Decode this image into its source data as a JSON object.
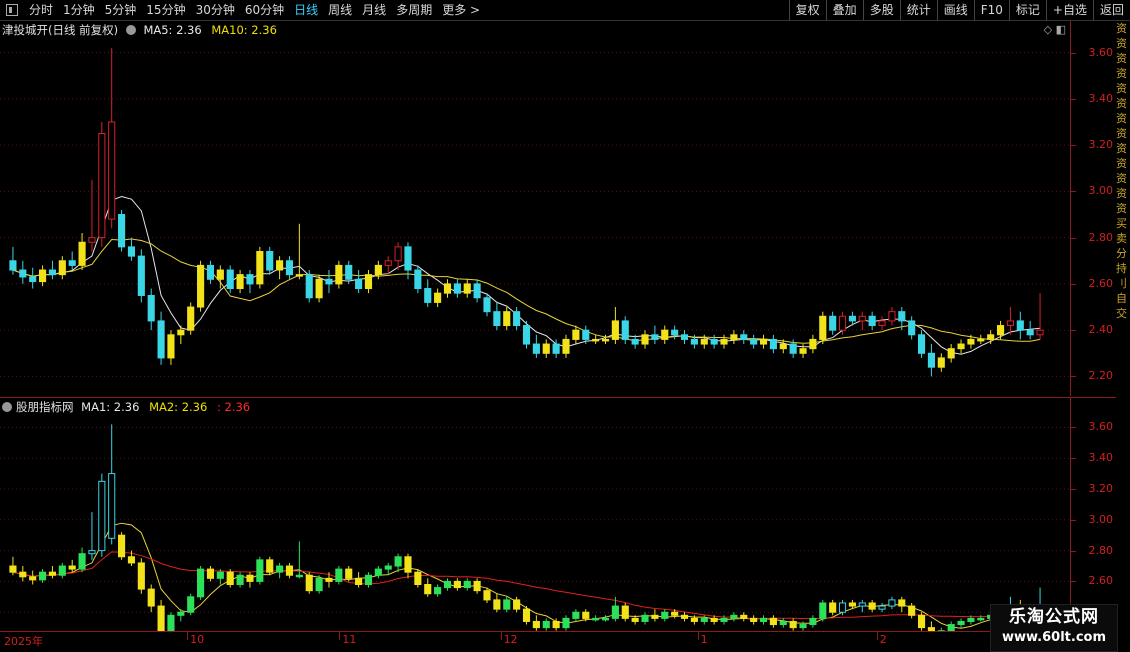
{
  "toolbar": {
    "periods": [
      "分时",
      "1分钟",
      "5分钟",
      "15分钟",
      "30分钟",
      "60分钟",
      "日线",
      "周线",
      "月线",
      "多周期",
      "更多 >"
    ],
    "active_period": "日线",
    "actions": [
      "复权",
      "叠加",
      "多股",
      "统计",
      "画线",
      "F10",
      "标记",
      "+自选",
      "返回"
    ]
  },
  "main": {
    "title": "津投城开(日线 前复权)",
    "ma5": "MA5: 2.36",
    "ma10": "MA10: 2.36",
    "ticks": [
      "3.60",
      "3.40",
      "3.20",
      "3.00",
      "2.80",
      "2.60",
      "2.40",
      "2.20"
    ]
  },
  "sub": {
    "title": "股朋指标网",
    "ma1": "MA1: 2.36",
    "ma2": "MA2: 2.36",
    "ma3": ": 2.36",
    "ticks": [
      "3.60",
      "3.40",
      "3.20",
      "3.00",
      "2.80",
      "2.60",
      "2.40"
    ]
  },
  "dates": [
    "2025年",
    "10",
    "11",
    "12",
    "1",
    "2",
    "3"
  ],
  "side_strip": [
    "资",
    "资",
    "资",
    "资",
    "资",
    "资",
    "资",
    "资",
    "资",
    "资",
    "资",
    "资",
    "资",
    "买",
    "卖",
    "分",
    "持",
    "刂",
    "自",
    "交"
  ],
  "watermark": {
    "title": "乐淘公式网",
    "url": "www.60lt.com"
  },
  "colors": {
    "up_red": "#d8202a",
    "up_yellow": "#f2e21a",
    "down_cyan": "#3ad6e6",
    "ma_white": "#e6e6e6",
    "ma_yellow": "#e8d23a",
    "ma_red": "#e02020",
    "accent": "#3ad1ff"
  },
  "chart_data": {
    "type": "candlestick",
    "axis_range": [
      2.15,
      3.65
    ],
    "sub_axis_range": [
      2.33,
      3.7
    ],
    "ma5_last": 2.36,
    "ma10_last": 2.36,
    "candles": [
      [
        2.7,
        2.76,
        2.64,
        2.66
      ],
      [
        2.66,
        2.7,
        2.6,
        2.63
      ],
      [
        2.63,
        2.67,
        2.58,
        2.61
      ],
      [
        2.61,
        2.68,
        2.59,
        2.66
      ],
      [
        2.66,
        2.7,
        2.62,
        2.64
      ],
      [
        2.64,
        2.72,
        2.62,
        2.7
      ],
      [
        2.7,
        2.74,
        2.66,
        2.68
      ],
      [
        2.68,
        2.82,
        2.66,
        2.78
      ],
      [
        2.78,
        3.05,
        2.74,
        2.8
      ],
      [
        2.8,
        3.3,
        2.76,
        3.25
      ],
      [
        2.88,
        3.62,
        2.84,
        3.3
      ],
      [
        2.9,
        2.92,
        2.74,
        2.76
      ],
      [
        2.76,
        2.8,
        2.7,
        2.72
      ],
      [
        2.72,
        2.75,
        2.52,
        2.55
      ],
      [
        2.55,
        2.58,
        2.4,
        2.44
      ],
      [
        2.44,
        2.48,
        2.25,
        2.28
      ],
      [
        2.28,
        2.4,
        2.25,
        2.38
      ],
      [
        2.38,
        2.42,
        2.34,
        2.4
      ],
      [
        2.4,
        2.52,
        2.38,
        2.5
      ],
      [
        2.5,
        2.7,
        2.48,
        2.68
      ],
      [
        2.68,
        2.7,
        2.6,
        2.62
      ],
      [
        2.62,
        2.68,
        2.58,
        2.66
      ],
      [
        2.66,
        2.68,
        2.56,
        2.58
      ],
      [
        2.58,
        2.66,
        2.56,
        2.64
      ],
      [
        2.64,
        2.66,
        2.56,
        2.6
      ],
      [
        2.6,
        2.76,
        2.58,
        2.74
      ],
      [
        2.74,
        2.76,
        2.64,
        2.66
      ],
      [
        2.66,
        2.72,
        2.62,
        2.7
      ],
      [
        2.7,
        2.72,
        2.62,
        2.64
      ],
      [
        2.64,
        2.86,
        2.62,
        2.64
      ],
      [
        2.64,
        2.66,
        2.52,
        2.54
      ],
      [
        2.54,
        2.64,
        2.52,
        2.62
      ],
      [
        2.62,
        2.66,
        2.56,
        2.6
      ],
      [
        2.6,
        2.7,
        2.58,
        2.68
      ],
      [
        2.68,
        2.7,
        2.6,
        2.62
      ],
      [
        2.62,
        2.66,
        2.56,
        2.58
      ],
      [
        2.58,
        2.66,
        2.56,
        2.64
      ],
      [
        2.64,
        2.7,
        2.62,
        2.68
      ],
      [
        2.68,
        2.72,
        2.64,
        2.7
      ],
      [
        2.7,
        2.78,
        2.66,
        2.76
      ],
      [
        2.76,
        2.78,
        2.62,
        2.66
      ],
      [
        2.66,
        2.68,
        2.56,
        2.58
      ],
      [
        2.58,
        2.62,
        2.5,
        2.52
      ],
      [
        2.52,
        2.58,
        2.5,
        2.56
      ],
      [
        2.56,
        2.62,
        2.54,
        2.6
      ],
      [
        2.6,
        2.62,
        2.54,
        2.56
      ],
      [
        2.56,
        2.62,
        2.54,
        2.6
      ],
      [
        2.6,
        2.62,
        2.52,
        2.54
      ],
      [
        2.54,
        2.56,
        2.46,
        2.48
      ],
      [
        2.48,
        2.52,
        2.4,
        2.42
      ],
      [
        2.42,
        2.5,
        2.4,
        2.48
      ],
      [
        2.48,
        2.5,
        2.4,
        2.42
      ],
      [
        2.42,
        2.44,
        2.32,
        2.34
      ],
      [
        2.34,
        2.38,
        2.28,
        2.3
      ],
      [
        2.3,
        2.36,
        2.28,
        2.34
      ],
      [
        2.34,
        2.36,
        2.28,
        2.3
      ],
      [
        2.3,
        2.38,
        2.28,
        2.36
      ],
      [
        2.36,
        2.42,
        2.34,
        2.4
      ],
      [
        2.4,
        2.42,
        2.34,
        2.36
      ],
      [
        2.36,
        2.38,
        2.34,
        2.36
      ],
      [
        2.36,
        2.38,
        2.34,
        2.36
      ],
      [
        2.36,
        2.5,
        2.34,
        2.44
      ],
      [
        2.44,
        2.46,
        2.34,
        2.36
      ],
      [
        2.36,
        2.38,
        2.32,
        2.34
      ],
      [
        2.34,
        2.4,
        2.32,
        2.38
      ],
      [
        2.38,
        2.42,
        2.34,
        2.36
      ],
      [
        2.36,
        2.42,
        2.34,
        2.4
      ],
      [
        2.4,
        2.42,
        2.36,
        2.38
      ],
      [
        2.38,
        2.4,
        2.34,
        2.36
      ],
      [
        2.36,
        2.38,
        2.32,
        2.34
      ],
      [
        2.34,
        2.38,
        2.32,
        2.36
      ],
      [
        2.36,
        2.38,
        2.32,
        2.34
      ],
      [
        2.34,
        2.38,
        2.32,
        2.36
      ],
      [
        2.36,
        2.4,
        2.34,
        2.38
      ],
      [
        2.38,
        2.4,
        2.34,
        2.36
      ],
      [
        2.36,
        2.38,
        2.32,
        2.34
      ],
      [
        2.34,
        2.38,
        2.32,
        2.36
      ],
      [
        2.36,
        2.38,
        2.3,
        2.32
      ],
      [
        2.32,
        2.36,
        2.3,
        2.34
      ],
      [
        2.34,
        2.36,
        2.28,
        2.3
      ],
      [
        2.3,
        2.34,
        2.28,
        2.32
      ],
      [
        2.32,
        2.38,
        2.3,
        2.36
      ],
      [
        2.36,
        2.48,
        2.34,
        2.46
      ],
      [
        2.46,
        2.48,
        2.38,
        2.4
      ],
      [
        2.4,
        2.48,
        2.38,
        2.46
      ],
      [
        2.46,
        2.48,
        2.42,
        2.44
      ],
      [
        2.44,
        2.48,
        2.4,
        2.46
      ],
      [
        2.46,
        2.48,
        2.4,
        2.42
      ],
      [
        2.42,
        2.46,
        2.4,
        2.44
      ],
      [
        2.44,
        2.5,
        2.42,
        2.48
      ],
      [
        2.48,
        2.5,
        2.4,
        2.44
      ],
      [
        2.44,
        2.46,
        2.36,
        2.38
      ],
      [
        2.38,
        2.4,
        2.28,
        2.3
      ],
      [
        2.3,
        2.34,
        2.2,
        2.24
      ],
      [
        2.24,
        2.3,
        2.22,
        2.28
      ],
      [
        2.28,
        2.34,
        2.26,
        2.32
      ],
      [
        2.32,
        2.36,
        2.3,
        2.34
      ],
      [
        2.34,
        2.38,
        2.32,
        2.36
      ],
      [
        2.36,
        2.38,
        2.34,
        2.36
      ],
      [
        2.36,
        2.4,
        2.34,
        2.38
      ],
      [
        2.38,
        2.44,
        2.36,
        2.42
      ],
      [
        2.42,
        2.5,
        2.38,
        2.44
      ],
      [
        2.44,
        2.48,
        2.36,
        2.4
      ],
      [
        2.4,
        2.44,
        2.36,
        2.38
      ],
      [
        2.38,
        2.56,
        2.36,
        2.4
      ]
    ],
    "up_color_pattern": "red"
  }
}
